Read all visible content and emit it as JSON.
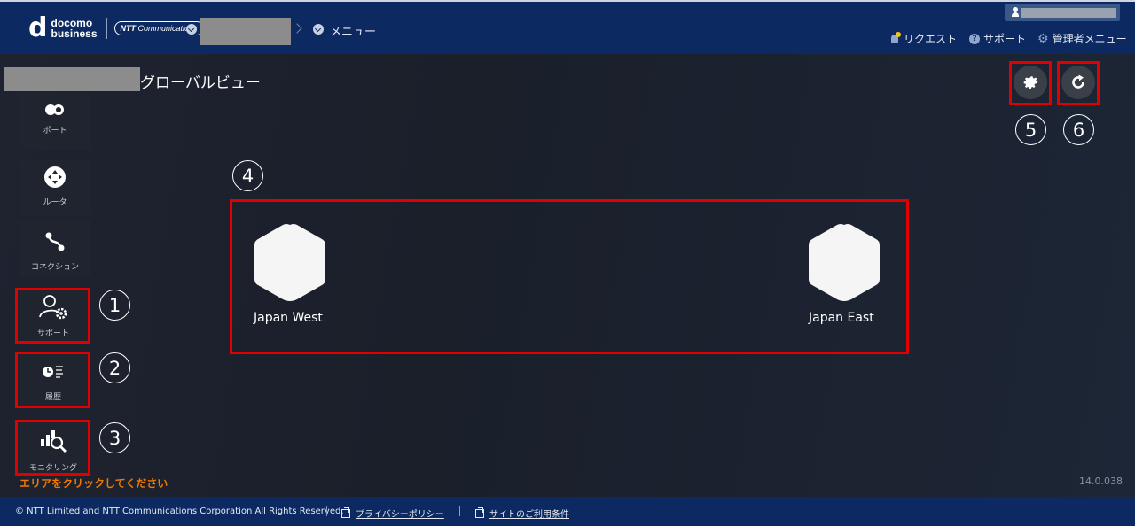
{
  "header": {
    "logo_main": "d",
    "logo_line1": "docomo",
    "logo_line2": "business",
    "logo_ntt": "NTT",
    "logo_ntt_sub": "Communications",
    "breadcrumb_menu": "メニュー",
    "nav": {
      "request": "リクエスト",
      "support": "サポート",
      "admin_menu": "管理者メニュー"
    }
  },
  "main": {
    "title_suffix": "グローバルビュー",
    "sidebar": [
      {
        "key": "port",
        "label": "ポート"
      },
      {
        "key": "router",
        "label": "ルータ"
      },
      {
        "key": "connection",
        "label": "コネクション"
      },
      {
        "key": "support",
        "label": "サポート"
      },
      {
        "key": "history",
        "label": "履歴"
      },
      {
        "key": "monitoring",
        "label": "モニタリング"
      }
    ],
    "annotations": [
      "1",
      "2",
      "3",
      "4",
      "5",
      "6"
    ],
    "regions": [
      {
        "name": "Japan West"
      },
      {
        "name": "Japan East"
      }
    ],
    "hint": "エリアをクリックしてください",
    "version": "14.0.038"
  },
  "footer": {
    "copyright": "© NTT Limited and NTT Communications Corporation All Rights Reserved.",
    "privacy": "プライバシーポリシー",
    "terms": "サイトのご利用条件"
  },
  "colors": {
    "header_bg": "#0c2961",
    "annotation_red": "#e00000",
    "hint_orange": "#f07a00"
  }
}
